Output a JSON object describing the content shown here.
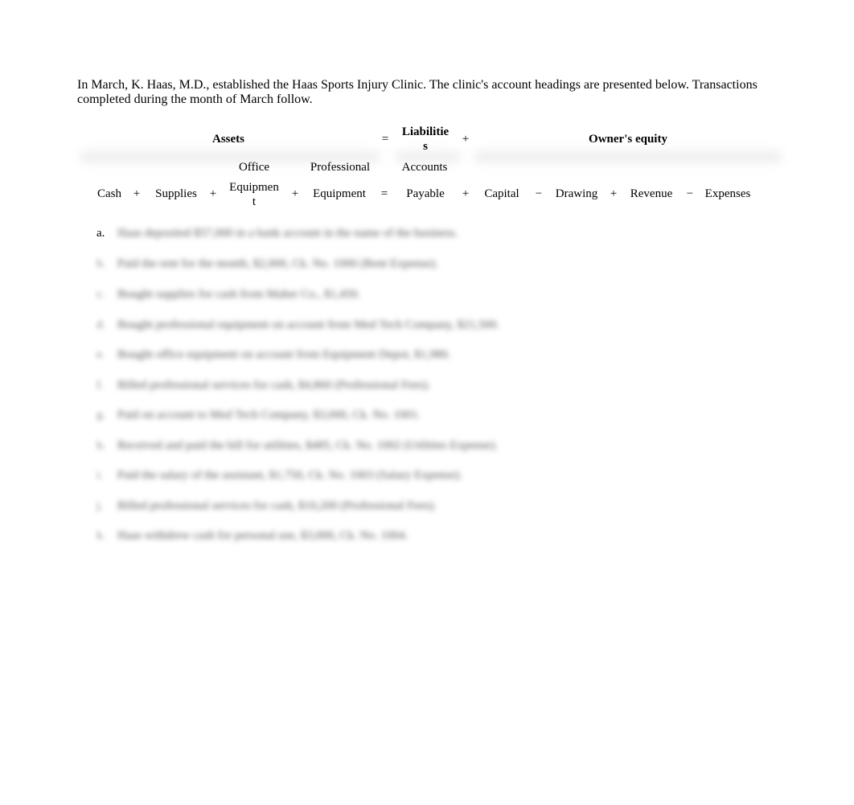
{
  "intro": "In March, K. Haas, M.D., established the Haas Sports Injury Clinic. The clinic's account headings are presented below. Transactions completed during the month of March follow.",
  "equation": {
    "groups": {
      "assets": "Assets",
      "eq": "=",
      "liabilities_line1": "Liabilitie",
      "liabilities_line2": "s",
      "plus": "+",
      "owners_equity": "Owner's equity"
    },
    "columns": {
      "cash": "Cash",
      "op1": "+",
      "supplies": "Supplies",
      "op2": "+",
      "office_equipment_top": "Office",
      "office_equipment_l1": "Equipmen",
      "office_equipment_l2": "t",
      "op3": "+",
      "professional_equipment_top": "Professional",
      "professional_equipment": "Equipment",
      "op4": "=",
      "accounts_payable_top": "Accounts",
      "accounts_payable": "Payable",
      "op5": "+",
      "capital": "Capital",
      "op6": "−",
      "drawing": "Drawing",
      "op7": "+",
      "revenue": "Revenue",
      "op8": "−",
      "expenses": "Expenses"
    }
  },
  "transactions": [
    {
      "label": "a.",
      "text": "Haas deposited $57,000 in a bank account in the name of the business."
    },
    {
      "label": "b.",
      "text": "Paid the rent for the month, $2,000, Ck. No. 1000 (Rent Expense)."
    },
    {
      "label": "c.",
      "text": "Bought supplies for cash from Maher Co., $1,450."
    },
    {
      "label": "d.",
      "text": "Bought professional equipment on account from Med Tech Company, $21,500."
    },
    {
      "label": "e.",
      "text": "Bought office equipment on account from Equipment Depot, $1,980."
    },
    {
      "label": "f.",
      "text": "Billed professional services for cash, $4,860 (Professional Fees)."
    },
    {
      "label": "g.",
      "text": "Paid on account to Med Tech Company, $3,000, Ck. No. 1001."
    },
    {
      "label": "h.",
      "text": "Received and paid the bill for utilities, $485, Ck. No. 1002 (Utilities Expense)."
    },
    {
      "label": "i.",
      "text": "Paid the salary of the assistant, $1,750, Ck. No. 1003 (Salary Expense)."
    },
    {
      "label": "j.",
      "text": "Billed professional services for cash, $10,200 (Professional Fees)."
    },
    {
      "label": "k.",
      "text": "Haas withdrew cash for personal use, $3,000, Ck. No. 1004."
    }
  ]
}
